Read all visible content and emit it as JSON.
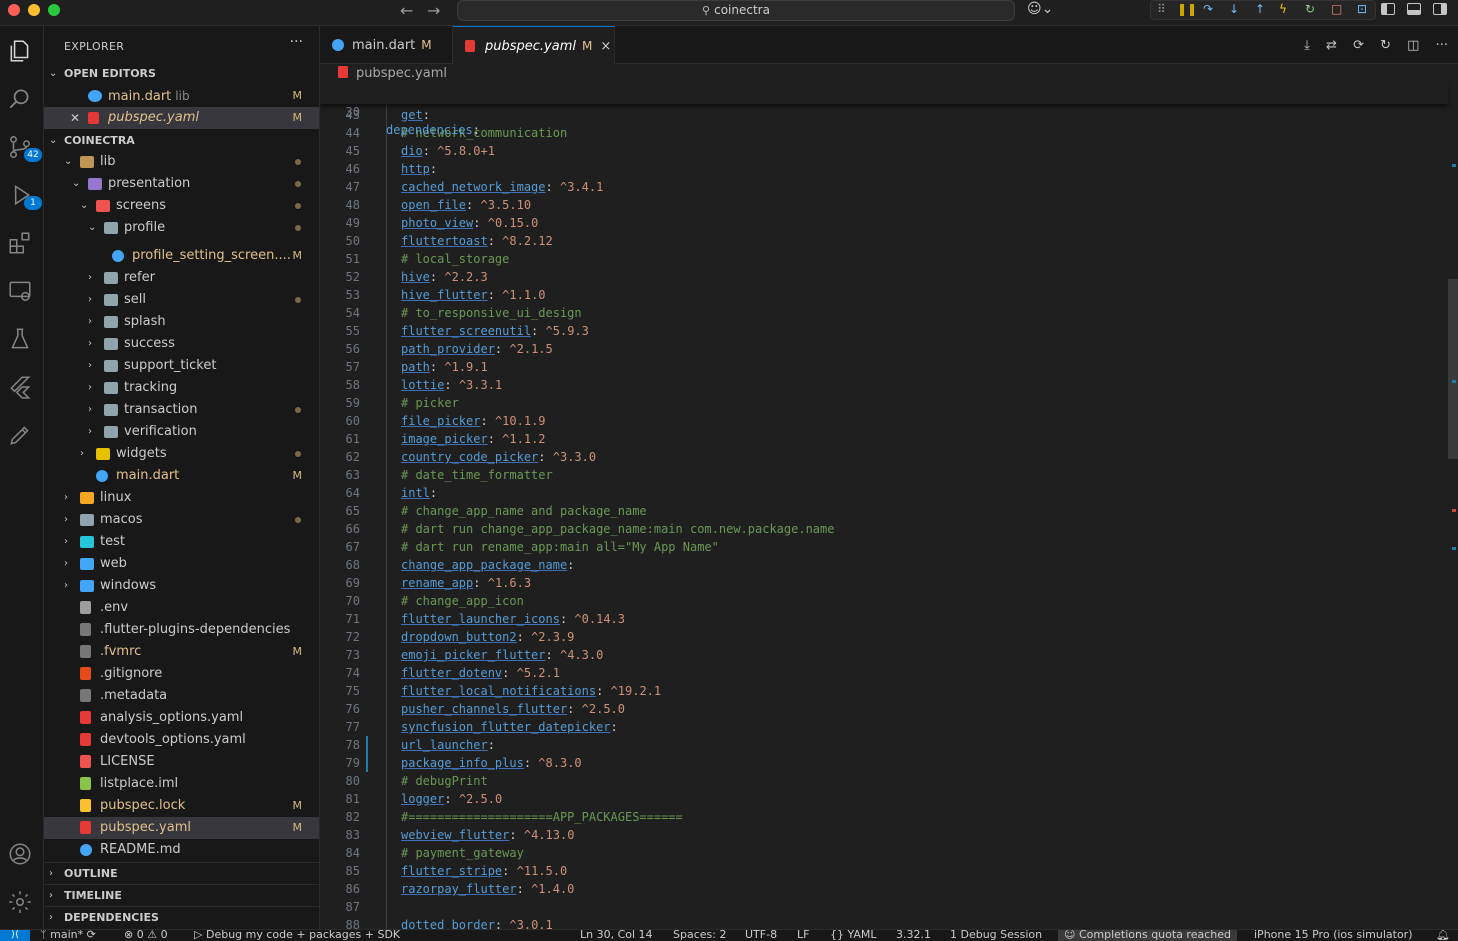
{
  "window": {
    "search_text": "coinectra"
  },
  "explorer": {
    "title": "EXPLORER",
    "more": "···",
    "open_editors_label": "OPEN EDITORS",
    "open_editors": [
      {
        "name": "main.dart",
        "desc": "lib",
        "status": "M"
      },
      {
        "name": "pubspec.yaml",
        "desc": "",
        "status": "M"
      }
    ],
    "project_label": "COINECTRA",
    "tree": [
      {
        "name": "lib",
        "status": ""
      },
      {
        "name": "presentation",
        "status": ""
      },
      {
        "name": "screens",
        "status": ""
      },
      {
        "name": "profile",
        "status": ""
      },
      {
        "name": "profile_setting_screen....",
        "status": "M"
      },
      {
        "name": "refer",
        "status": ""
      },
      {
        "name": "sell",
        "status": ""
      },
      {
        "name": "splash",
        "status": ""
      },
      {
        "name": "success",
        "status": ""
      },
      {
        "name": "support_ticket",
        "status": ""
      },
      {
        "name": "tracking",
        "status": ""
      },
      {
        "name": "transaction",
        "status": ""
      },
      {
        "name": "verification",
        "status": ""
      },
      {
        "name": "widgets",
        "status": ""
      },
      {
        "name": "main.dart",
        "status": "M"
      },
      {
        "name": "linux",
        "status": ""
      },
      {
        "name": "macos",
        "status": ""
      },
      {
        "name": "test",
        "status": ""
      },
      {
        "name": "web",
        "status": ""
      },
      {
        "name": "windows",
        "status": ""
      },
      {
        "name": ".env",
        "status": ""
      },
      {
        "name": ".flutter-plugins-dependencies",
        "status": ""
      },
      {
        "name": ".fvmrc",
        "status": "M"
      },
      {
        "name": ".gitignore",
        "status": ""
      },
      {
        "name": ".metadata",
        "status": ""
      },
      {
        "name": "analysis_options.yaml",
        "status": ""
      },
      {
        "name": "devtools_options.yaml",
        "status": ""
      },
      {
        "name": "LICENSE",
        "status": ""
      },
      {
        "name": "listplace.iml",
        "status": ""
      },
      {
        "name": "pubspec.lock",
        "status": "M"
      },
      {
        "name": "pubspec.yaml",
        "status": "M"
      },
      {
        "name": "README.md",
        "status": ""
      }
    ],
    "outline_label": "OUTLINE",
    "timeline_label": "TIMELINE",
    "dependencies_label": "DEPENDENCIES"
  },
  "activity": {
    "scm_badge": "42",
    "debug_badge": "1"
  },
  "tabs": [
    {
      "name": "main.dart",
      "status": "M"
    },
    {
      "name": "pubspec.yaml",
      "status": "M",
      "close": "×"
    }
  ],
  "editor": {
    "breadcrumb": "pubspec.yaml",
    "sticky": {
      "num": "30",
      "key": "dependencies",
      "punct": ":"
    },
    "lines": [
      {
        "n": "43",
        "k": "get",
        "v": ""
      },
      {
        "n": "44",
        "c": "# network_communication"
      },
      {
        "n": "45",
        "k": "dio",
        "v": "^5.8.0+1"
      },
      {
        "n": "46",
        "k": "http",
        "v": ""
      },
      {
        "n": "47",
        "k": "cached_network_image",
        "v": "^3.4.1"
      },
      {
        "n": "48",
        "k": "open_file",
        "v": "^3.5.10"
      },
      {
        "n": "49",
        "k": "photo_view",
        "v": "^0.15.0"
      },
      {
        "n": "50",
        "k": "fluttertoast",
        "v": "^8.2.12"
      },
      {
        "n": "51",
        "c": "# local_storage"
      },
      {
        "n": "52",
        "k": "hive",
        "v": "^2.2.3"
      },
      {
        "n": "53",
        "k": "hive_flutter",
        "v": "^1.1.0"
      },
      {
        "n": "54",
        "c": "# to_responsive_ui_design"
      },
      {
        "n": "55",
        "k": "flutter_screenutil",
        "v": "^5.9.3"
      },
      {
        "n": "56",
        "k": "path_provider",
        "v": "^2.1.5"
      },
      {
        "n": "57",
        "k": "path",
        "v": "^1.9.1"
      },
      {
        "n": "58",
        "k": "lottie",
        "v": "^3.3.1"
      },
      {
        "n": "59",
        "c": "# picker"
      },
      {
        "n": "60",
        "k": "file_picker",
        "v": "^10.1.9"
      },
      {
        "n": "61",
        "k": "image_picker",
        "v": "^1.1.2"
      },
      {
        "n": "62",
        "k": "country_code_picker",
        "v": "^3.3.0"
      },
      {
        "n": "63",
        "c": "# date_time_formatter"
      },
      {
        "n": "64",
        "k": "intl",
        "v": ""
      },
      {
        "n": "65",
        "c": "# change_app_name and package_name"
      },
      {
        "n": "66",
        "c": "# dart run change_app_package_name:main com.new.package.name"
      },
      {
        "n": "67",
        "c": "# dart run rename_app:main all=\"My App Name\""
      },
      {
        "n": "68",
        "k": "change_app_package_name",
        "v": ""
      },
      {
        "n": "69",
        "k": "rename_app",
        "v": "^1.6.3"
      },
      {
        "n": "70",
        "c": "# change_app_icon"
      },
      {
        "n": "71",
        "k": "flutter_launcher_icons",
        "v": "^0.14.3"
      },
      {
        "n": "72",
        "k": "dropdown_button2",
        "v": "^2.3.9"
      },
      {
        "n": "73",
        "k": "emoji_picker_flutter",
        "v": "^4.3.0"
      },
      {
        "n": "74",
        "k": "flutter_dotenv",
        "v": "^5.2.1"
      },
      {
        "n": "75",
        "k": "flutter_local_notifications",
        "v": "^19.2.1"
      },
      {
        "n": "76",
        "k": "pusher_channels_flutter",
        "v": "^2.5.0"
      },
      {
        "n": "77",
        "k": "syncfusion_flutter_datepicker",
        "v": ""
      },
      {
        "n": "78",
        "k": "url_launcher",
        "v": ""
      },
      {
        "n": "79",
        "k": "package_info_plus",
        "v": "^8.3.0"
      },
      {
        "n": "80",
        "c": "# debugPrint"
      },
      {
        "n": "81",
        "k": "logger",
        "v": "^2.5.0"
      },
      {
        "n": "82",
        "c": "#====================APP_PACKAGES======"
      },
      {
        "n": "83",
        "k": "webview_flutter",
        "v": "^4.13.0"
      },
      {
        "n": "84",
        "c": "# payment_gateway"
      },
      {
        "n": "85",
        "k": "flutter_stripe",
        "v": "^11.5.0"
      },
      {
        "n": "86",
        "k": "razorpay_flutter",
        "v": "^1.4.0"
      },
      {
        "n": "87",
        "c": ""
      },
      {
        "n": "88",
        "k": "dotted_border",
        "v": "^3.0.1"
      }
    ]
  },
  "status": {
    "branch": "main*",
    "problems": "⊗ 0 ⚠ 0",
    "debug": "Debug my code + packages + SDK",
    "position": "Ln 30, Col 14",
    "spaces": "Spaces: 2",
    "encoding": "UTF-8",
    "eol": "LF",
    "language": "YAML",
    "version": "3.32.1",
    "session": "1 Debug Session",
    "quota": "Completions quota reached",
    "device": "iPhone 15 Pro (ios simulator)"
  },
  "colors": {
    "accent": "#0078d4",
    "modified": "#e2c08d",
    "key": "#569cd6",
    "string": "#ce9178",
    "comment": "#6a9955"
  }
}
